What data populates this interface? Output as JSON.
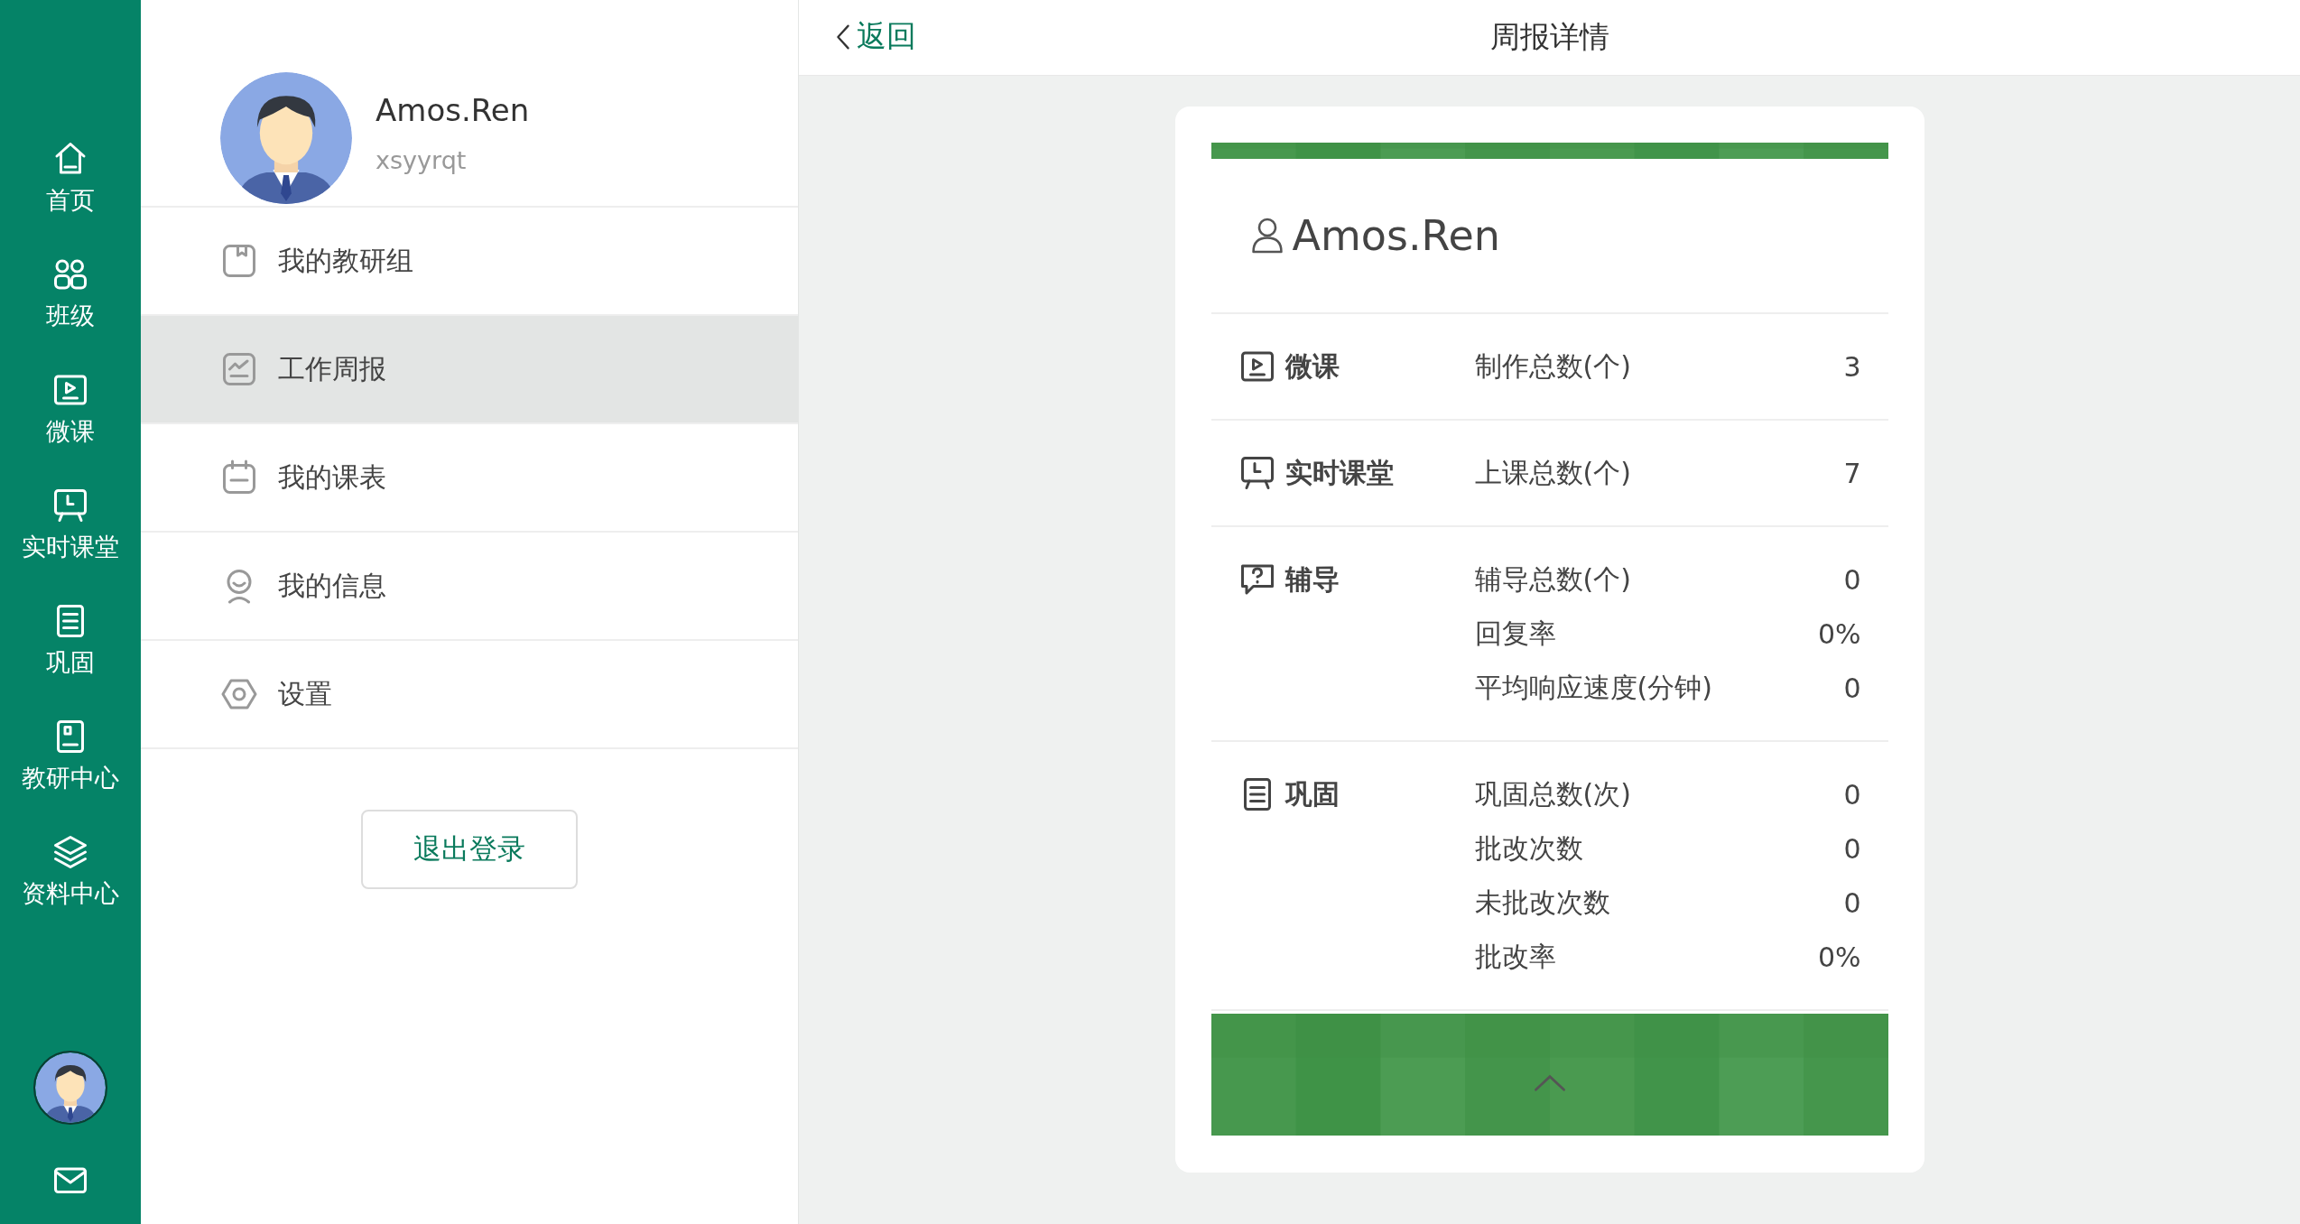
{
  "nav_rail": {
    "items": [
      {
        "kind": "home",
        "label": "首页"
      },
      {
        "kind": "class",
        "label": "班级"
      },
      {
        "kind": "video",
        "label": "微课"
      },
      {
        "kind": "board",
        "label": "实时课堂"
      },
      {
        "kind": "notes",
        "label": "巩固"
      },
      {
        "kind": "book",
        "label": "教研中心"
      },
      {
        "kind": "layers",
        "label": "资料中心"
      }
    ],
    "bottom": [
      {
        "kind": "avatar"
      },
      {
        "kind": "mail"
      }
    ]
  },
  "profile": {
    "name": "Amos.Ren",
    "username": "xsyyrqt"
  },
  "menu": [
    {
      "kind": "group",
      "label": "我的教研组",
      "selected": false
    },
    {
      "kind": "report",
      "label": "工作周报",
      "selected": true
    },
    {
      "kind": "calendar",
      "label": "我的课表",
      "selected": false
    },
    {
      "kind": "person",
      "label": "我的信息",
      "selected": false
    },
    {
      "kind": "settings",
      "label": "设置",
      "selected": false
    }
  ],
  "logout_button": "退出登录",
  "header": {
    "back": "返回",
    "title": "周报详情"
  },
  "report_card": {
    "name": "Amos.Ren",
    "sections": [
      {
        "kind": "video",
        "title": "微课",
        "metrics": [
          {
            "label": "制作总数(个)",
            "value": "3"
          }
        ]
      },
      {
        "kind": "board",
        "title": "实时课堂",
        "metrics": [
          {
            "label": "上课总数(个)",
            "value": "7"
          }
        ]
      },
      {
        "kind": "question",
        "title": "辅导",
        "metrics": [
          {
            "label": "辅导总数(个)",
            "value": "0"
          },
          {
            "label": "回复率",
            "value": "0%"
          },
          {
            "label": "平均响应速度(分钟)",
            "value": "0"
          }
        ]
      },
      {
        "kind": "notes",
        "title": "巩固",
        "metrics": [
          {
            "label": "巩固总数(次)",
            "value": "0"
          },
          {
            "label": "批改次数",
            "value": "0"
          },
          {
            "label": "未批改次数",
            "value": "0"
          },
          {
            "label": "批改率",
            "value": "0%"
          }
        ]
      }
    ]
  }
}
